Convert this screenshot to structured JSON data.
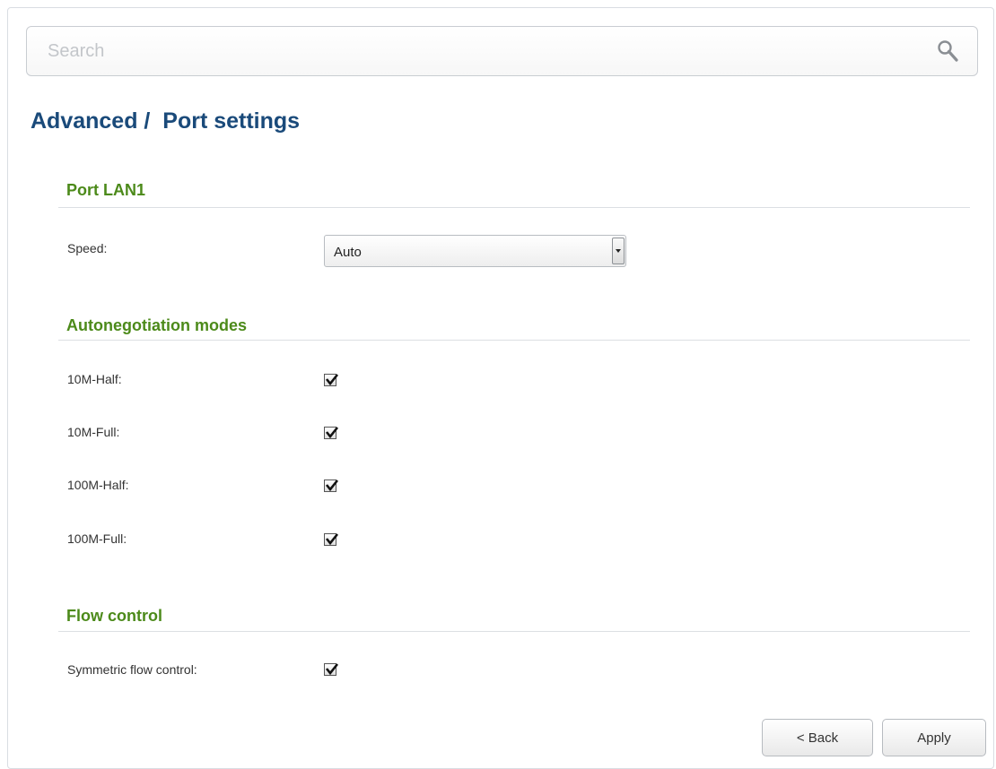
{
  "search": {
    "placeholder": "Search",
    "icon": "search-icon"
  },
  "page": {
    "title": "Advanced /  Port settings"
  },
  "port_section": {
    "title": "Port LAN1",
    "speed_label": "Speed:",
    "speed_value": "Auto"
  },
  "autoneg_section": {
    "title": "Autonegotiation modes",
    "modes": [
      {
        "label": "10M-Half:",
        "checked": true
      },
      {
        "label": "10M-Full:",
        "checked": true
      },
      {
        "label": "100M-Half:",
        "checked": true
      },
      {
        "label": "100M-Full:",
        "checked": true
      }
    ]
  },
  "flow_section": {
    "title": "Flow control",
    "symmetric_label": "Symmetric flow control:",
    "symmetric_checked": true
  },
  "buttons": {
    "back": "< Back",
    "apply": "Apply"
  },
  "colors": {
    "title": "#1a4a7a",
    "section_title": "#4c8a1a"
  }
}
